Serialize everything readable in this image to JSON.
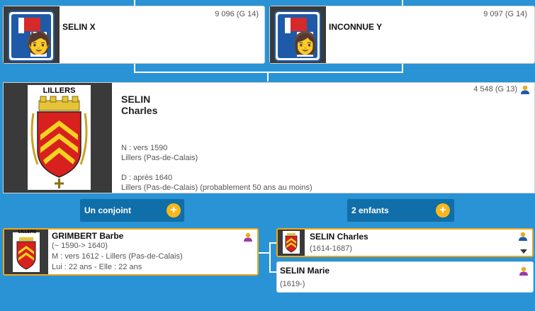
{
  "father": {
    "name": "SELIN X",
    "id": "9 096 (G 14)"
  },
  "mother": {
    "name": "INCONNUE Y",
    "id": "9 097 (G 14)"
  },
  "main": {
    "arms_title": "LILLERS",
    "surname": "SELIN",
    "given": "Charles",
    "id": "4 548 (G 13)",
    "birth_line": "N : vers 1590",
    "birth_place": "Lillers (Pas-de-Calais)",
    "death_line": "D : après 1640",
    "death_place": "Lillers (Pas-de-Calais) (probablement 50 ans au moins)"
  },
  "spouses_button": {
    "label": "Un conjoint"
  },
  "children_button": {
    "label": "2 enfants"
  },
  "spouse": {
    "thumb_title": "LILLERS",
    "name": "GRIMBERT Barbe",
    "dates": "(~ 1590-> 1640)",
    "marriage": "M : vers 1612 - Lillers (Pas-de-Calais)",
    "ages": "Lui : 22 ans - Elle : 22 ans"
  },
  "children": [
    {
      "name": "SELIN Charles",
      "dates": "(1614-1687)"
    },
    {
      "name": "SELIN Marie",
      "dates": "(1619-)"
    }
  ],
  "colors": {
    "background": "#2a93d5",
    "accent": "#f0a81a",
    "action": "#106ea8",
    "male": "#1e5aa8",
    "female": "#9b3aa8"
  }
}
